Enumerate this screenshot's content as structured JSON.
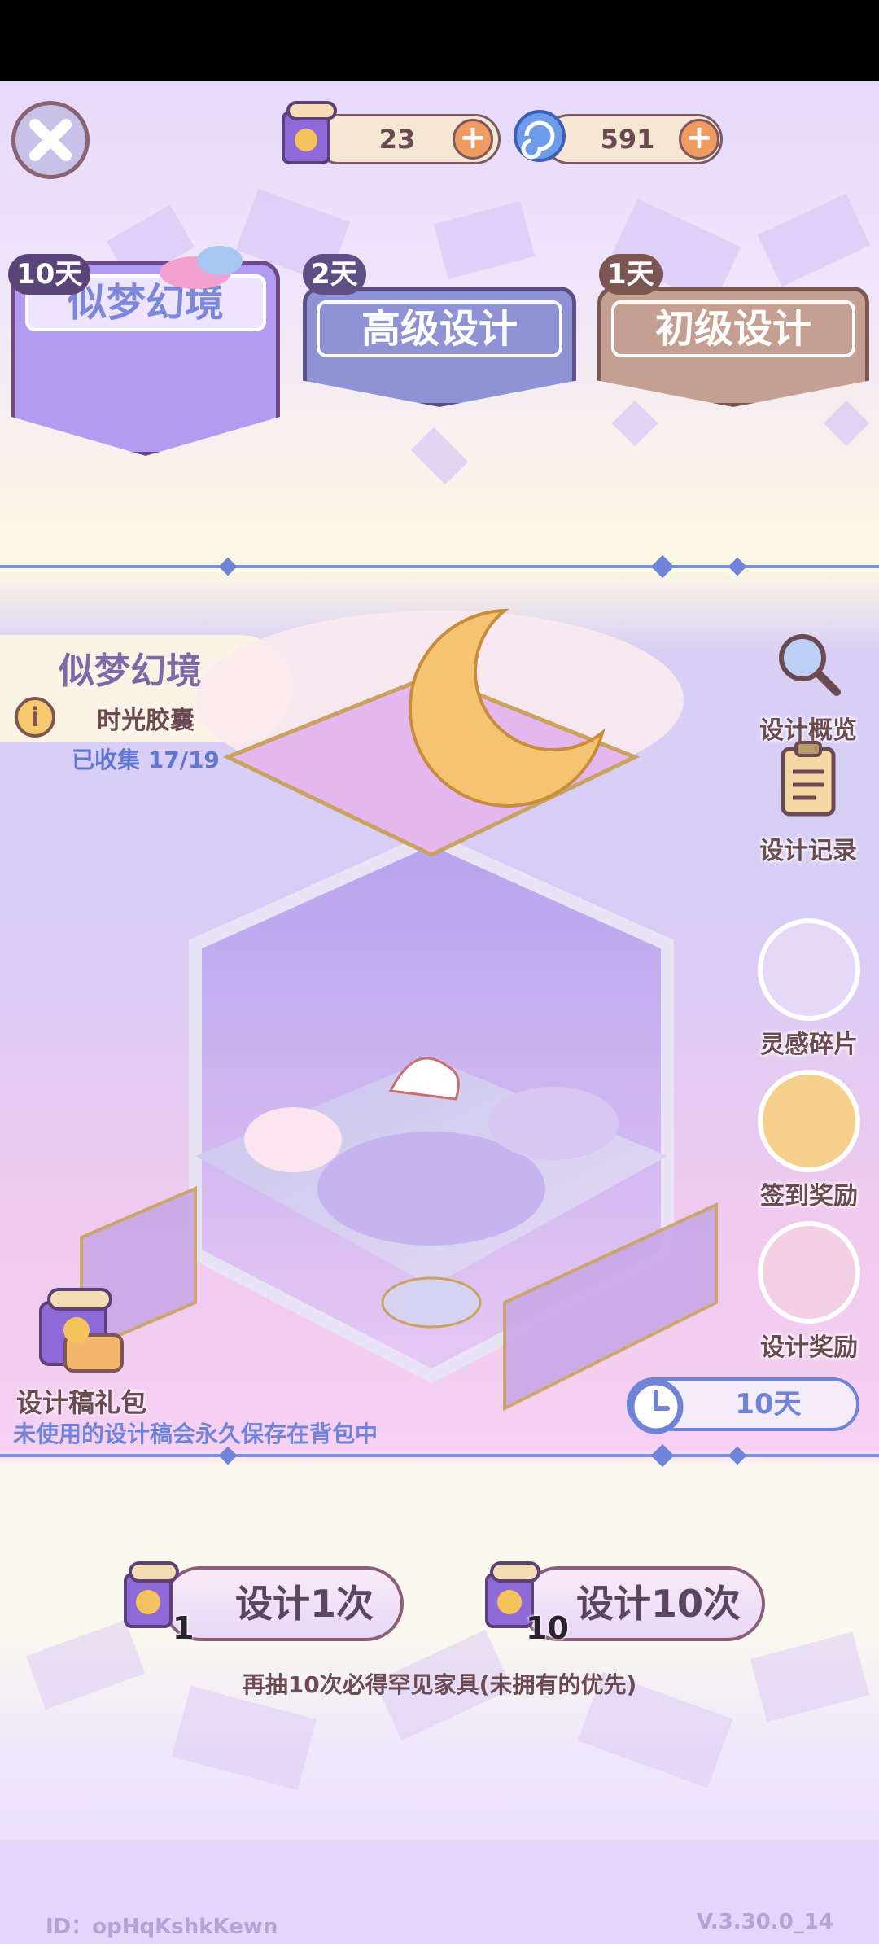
{
  "header": {
    "scroll_count": "23",
    "gem_count": "591"
  },
  "tabs": [
    {
      "badge": "10天",
      "label": "似梦幻境"
    },
    {
      "badge": "2天",
      "label": "高级设计"
    },
    {
      "badge": "1天",
      "label": "初级设计"
    }
  ],
  "info_card": {
    "title": "似梦幻境",
    "subtitle": "时光胶囊",
    "collected": "已收集 17/19"
  },
  "side_buttons": [
    {
      "label": "设计概览",
      "icon": "magnifier-icon"
    },
    {
      "label": "设计记录",
      "icon": "clipboard-icon"
    },
    {
      "label": "灵感碎片",
      "icon": "map-fragment-icon"
    },
    {
      "label": "签到奖励",
      "icon": "calendar-icon"
    },
    {
      "label": "设计奖励",
      "icon": "moon-cloud-icon"
    }
  ],
  "gift": {
    "label": "设计稿礼包",
    "note": "未使用的设计稿会永久保存在背包中"
  },
  "timer": "10天",
  "draw": {
    "one_label": "设计1次",
    "one_count": "1",
    "ten_label": "设计10次",
    "ten_count": "10",
    "hint": "再抽10次必得罕见家具(未拥有的优先)"
  },
  "footer": {
    "id": "ID：opHqKshkKewn",
    "version": "V.3.30.0_14"
  },
  "colors": {
    "accent_purple": "#a98ef0",
    "tab_blue": "#8f93d6",
    "tab_brown": "#c69f93",
    "text_brown": "#6c4a52",
    "text_blue": "#5f77cf"
  }
}
